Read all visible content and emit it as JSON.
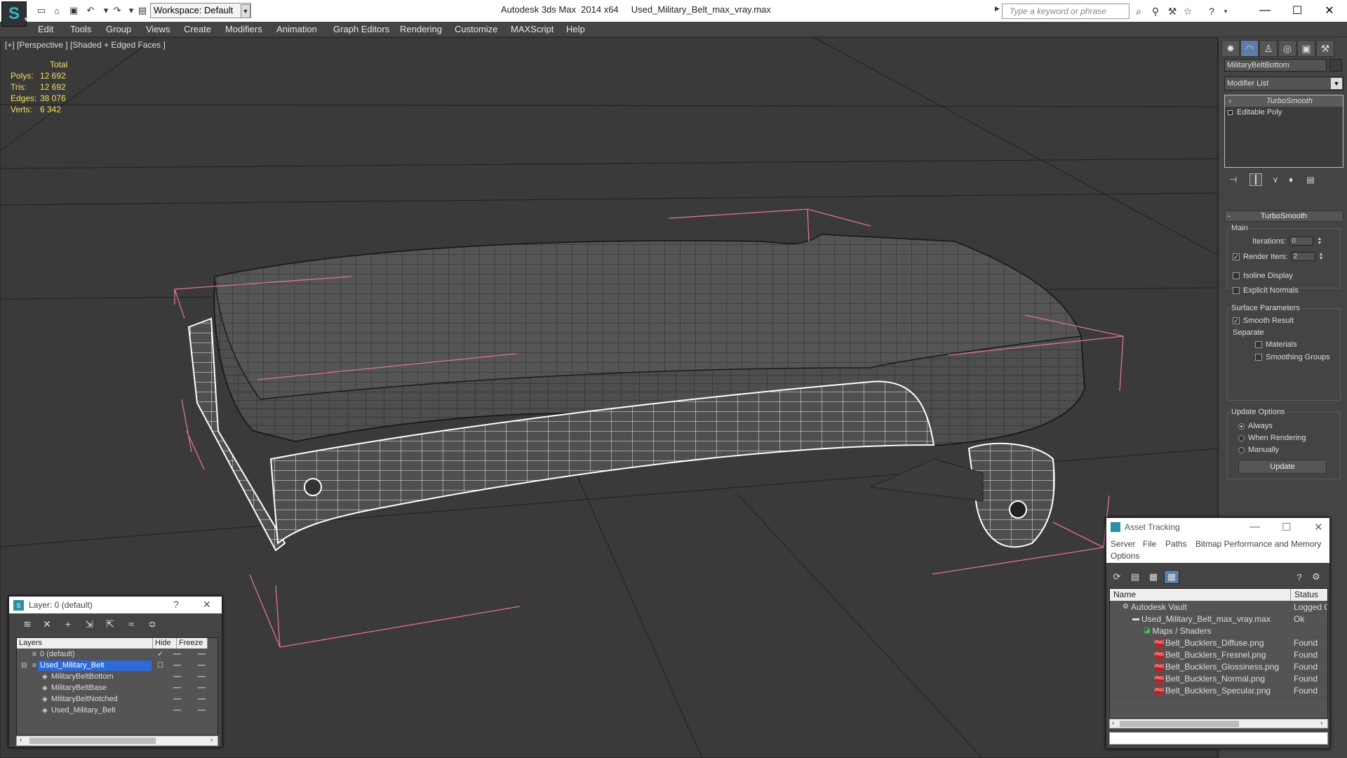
{
  "titlebar": {
    "workspace": "Workspace: Default",
    "app_name": "Autodesk 3ds Max  2014 x64",
    "file_name": "Used_Military_Belt_max_vray.max",
    "search_placeholder": "Type a keyword or phrase"
  },
  "menu": [
    "Edit",
    "Tools",
    "Group",
    "Views",
    "Create",
    "Modifiers",
    "Animation",
    "Graph Editors",
    "Rendering",
    "Customize",
    "MAXScript",
    "Help"
  ],
  "viewport": {
    "label": "[+] [Perspective ] [Shaded + Edged Faces ]",
    "stats": {
      "header": "Total",
      "rows": [
        {
          "label": "Polys:",
          "value": "12 692"
        },
        {
          "label": "Tris:",
          "value": "12 692"
        },
        {
          "label": "Edges:",
          "value": "38 076"
        },
        {
          "label": "Verts:",
          "value": "6 342"
        }
      ]
    }
  },
  "command_panel": {
    "object_name": "MilitaryBeltBottom",
    "modifier_list": "Modifier List",
    "stack": [
      "TurboSmooth",
      "Editable Poly"
    ],
    "rollout_title": "TurboSmooth",
    "main_group": "Main",
    "iterations_label": "Iterations:",
    "iterations_value": "0",
    "render_iters_label": "Render Iters:",
    "render_iters_value": "2",
    "isoline_display": "Isoline Display",
    "explicit_normals": "Explicit Normals",
    "surface_group": "Surface Parameters",
    "smooth_result": "Smooth Result",
    "separate": "Separate",
    "materials": "Materials",
    "smoothing_groups": "Smoothing Groups",
    "update_group": "Update Options",
    "always": "Always",
    "when_rendering": "When Rendering",
    "manually": "Manually",
    "update_button": "Update"
  },
  "layer_window": {
    "title": "Layer: 0 (default)",
    "columns": [
      "Layers",
      "Hide",
      "Freeze"
    ],
    "rows": [
      "0 (default)",
      "Used_Military_Belt",
      "MilitaryBeltBottom",
      "MilitaryBeltBase",
      "MilitaryBeltNotched",
      "Used_Military_Belt"
    ]
  },
  "asset_window": {
    "title": "Asset Tracking",
    "menu": [
      "Server",
      "File",
      "Paths",
      "Bitmap Performance and Memory",
      "Options"
    ],
    "columns": [
      "Name",
      "Status"
    ],
    "rows": [
      {
        "name": "Autodesk Vault",
        "status": "Logged O"
      },
      {
        "name": "Used_Military_Belt_max_vray.max",
        "status": "Ok"
      },
      {
        "name": "Maps / Shaders",
        "status": ""
      },
      {
        "name": "Belt_Bucklers_Diffuse.png",
        "status": "Found"
      },
      {
        "name": "Belt_Bucklers_Fresnel.png",
        "status": "Found"
      },
      {
        "name": "Belt_Bucklers_Glossiness.png",
        "status": "Found"
      },
      {
        "name": "Belt_Bucklers_Normal.png",
        "status": "Found"
      },
      {
        "name": "Belt_Bucklers_Specular.png",
        "status": "Found"
      }
    ]
  },
  "colors": {
    "viewport_bg": "#3a3a3a",
    "panel_bg": "#444444",
    "stats_text": "#f0e060",
    "bbox_pink": "#e0709a",
    "selection_blue": "#2d6ad6"
  }
}
